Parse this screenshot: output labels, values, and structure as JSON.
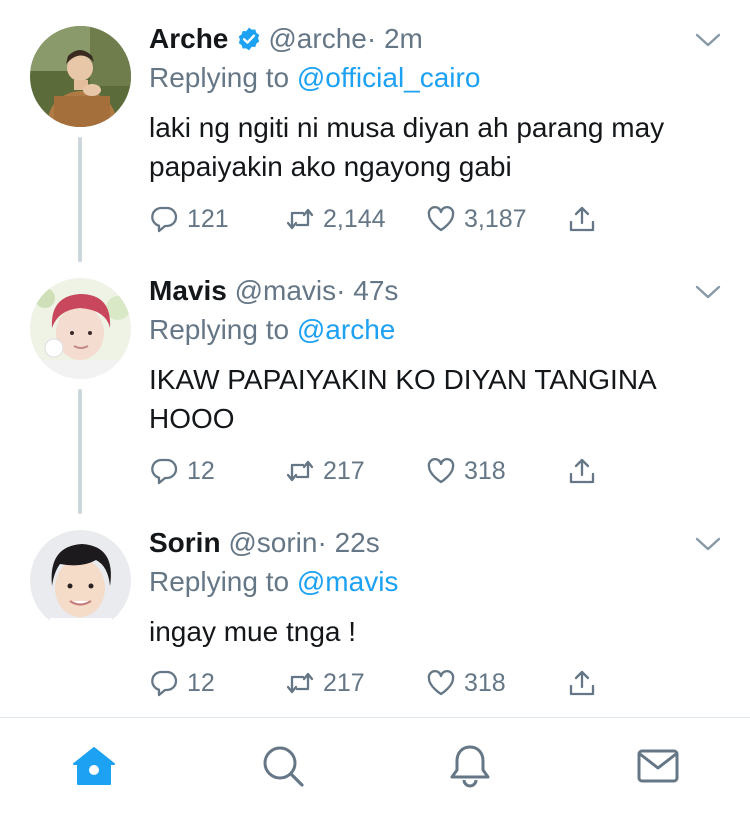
{
  "tweets": [
    {
      "name": "Arche",
      "verified": true,
      "handle": "@arche",
      "time": "· 2m",
      "replying_prefix": "Replying to",
      "replying_to": "@official_cairo",
      "text": "laki ng ngiti ni musa diyan ah parang may papaiyakin ako ngayong gabi",
      "replies": "121",
      "retweets": "2,144",
      "likes": "3,187"
    },
    {
      "name": "Mavis",
      "verified": false,
      "handle": "@mavis",
      "time": "· 47s",
      "replying_prefix": "Replying to",
      "replying_to": "@arche",
      "text": "IKAW PAPAIYAKIN KO DIYAN TANGINA HOOO",
      "replies": "12",
      "retweets": "217",
      "likes": "318"
    },
    {
      "name": "Sorin",
      "verified": false,
      "handle": "@sorin",
      "time": "· 22s",
      "replying_prefix": "Replying to",
      "replying_to": "@mavis",
      "text": "ingay mue tnga !",
      "replies": "12",
      "retweets": "217",
      "likes": "318"
    }
  ],
  "bottom_nav": [
    {
      "icon": "home-icon",
      "active": true
    },
    {
      "icon": "search-icon",
      "active": false
    },
    {
      "icon": "bell-icon",
      "active": false
    },
    {
      "icon": "mail-icon",
      "active": false
    }
  ],
  "colors": {
    "accent": "#1da1f2",
    "secondary_text": "#657786",
    "primary_text": "#14171a",
    "thread_line": "#ccd6dd",
    "divider": "#e1e8ed"
  }
}
